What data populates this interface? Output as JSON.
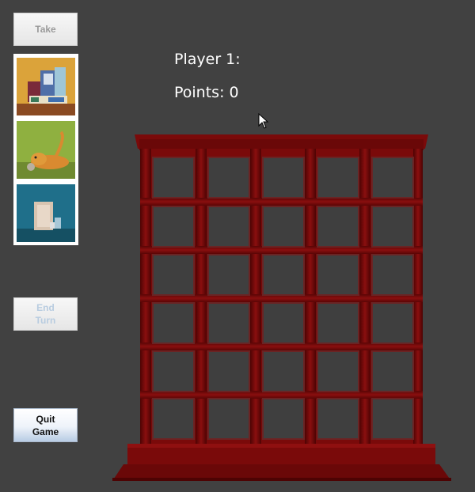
{
  "buttons": {
    "take": "Take",
    "end_turn": "End\nTurn",
    "quit": "Quit\nGame"
  },
  "player": {
    "label": "Player 1:",
    "points_label": "Points:",
    "points": "0"
  },
  "cards": [
    {
      "name": "boxes-card",
      "icon": "board-game-boxes"
    },
    {
      "name": "cat-card",
      "icon": "orange-cat"
    },
    {
      "name": "frame-card",
      "icon": "picture-frame"
    }
  ],
  "board": {
    "columns": 5,
    "rows": 6
  },
  "colors": {
    "background": "#414141",
    "cabinet_red": "#7a0a0a",
    "cabinet_dark": "#4d0303",
    "slot": "#3f3f3f"
  }
}
